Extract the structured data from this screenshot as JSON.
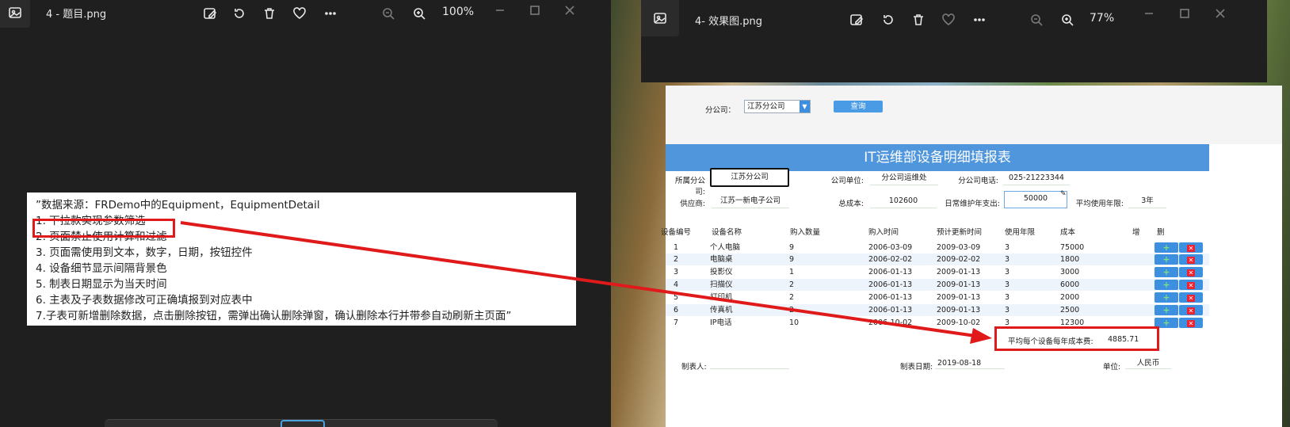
{
  "left_window": {
    "title": "4 - 题目.png",
    "zoom": "100%",
    "doc_lines": [
      "”数据来源：FRDemo中的Equipment，EquipmentDetail",
      "1. 下拉款实现参数筛选",
      "2. 页面禁止使用计算和过滤",
      "3. 页面需使用到文本，数字，日期，按钮控件",
      "4. 设备细节显示间隔背景色",
      "5. 制表日期显示为当天时间",
      "6. 主表及子表数据修改可正确填报到对应表中",
      "7.子表可新增删除数据，点击删除按钮，需弹出确认删除弹窗，确认删除本行并带参自动刷新主页面”"
    ]
  },
  "right_window": {
    "title": "4- 效果图.png",
    "zoom": "77%"
  },
  "report": {
    "filter_label": "分公司：",
    "filter_value": "江苏分公司",
    "query_label": "查询",
    "title": "IT运维部设备明细填报表",
    "fields": {
      "branch_label": "所属分公司:",
      "branch_value": "江苏分公司",
      "unit_label": "公司单位:",
      "unit_value": "分公司运维处",
      "phone_label": "分公司电话:",
      "phone_value": "025-21223344",
      "supplier_label": "供应商:",
      "supplier_value": "江苏一新电子公司",
      "total_label": "总成本:",
      "total_value": "102600",
      "maint_label": "日常维护年支出:",
      "maint_value": "50000",
      "years_label": "平均使用年限:",
      "years_value": "3年"
    },
    "headers": [
      "设备编号",
      "设备名称",
      "购入数量",
      "购入时间",
      "预计更新时间",
      "使用年限",
      "成本",
      "增",
      "删"
    ],
    "rows": [
      [
        "1",
        "个人电脑",
        "9",
        "2006-03-09",
        "2009-03-09",
        "3",
        "75000"
      ],
      [
        "2",
        "电脑桌",
        "9",
        "2006-02-02",
        "2009-02-02",
        "3",
        "1800"
      ],
      [
        "3",
        "投影仪",
        "1",
        "2006-01-13",
        "2009-01-13",
        "3",
        "3000"
      ],
      [
        "4",
        "扫描仪",
        "2",
        "2006-01-13",
        "2009-01-13",
        "3",
        "6000"
      ],
      [
        "5",
        "打印机",
        "2",
        "2006-01-13",
        "2009-01-13",
        "3",
        "2000"
      ],
      [
        "6",
        "传真机",
        "2",
        "2006-01-13",
        "2009-01-13",
        "3",
        "2500"
      ],
      [
        "7",
        "IP电话",
        "10",
        "2006-10-02",
        "2009-10-02",
        "3",
        "12300"
      ]
    ],
    "avg_label": "平均每个设备每年成本费:",
    "avg_value": "4885.71",
    "maker_label": "制表人:",
    "date_label": "制表日期:",
    "date_value": "2019-08-18",
    "unit2_label": "单位:",
    "unit2_value": "人民币"
  },
  "colors": {
    "accent": "#4f96dc",
    "highlight": "#e01a1a"
  }
}
